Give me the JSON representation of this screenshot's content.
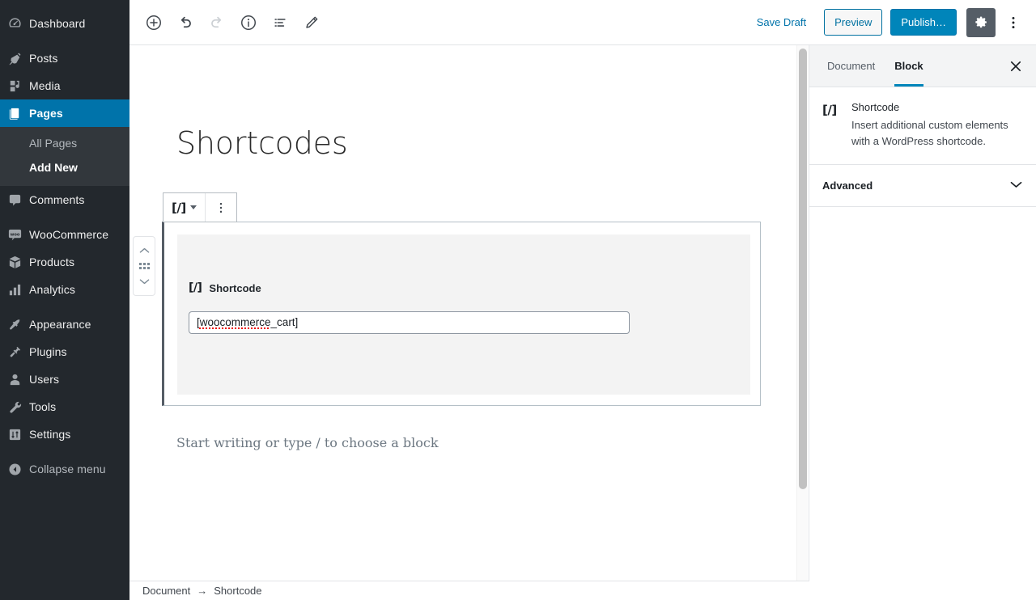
{
  "admin_menu": {
    "items": [
      {
        "label": "Dashboard",
        "icon": "dashboard-icon",
        "current": false,
        "gap_after": true
      },
      {
        "label": "Posts",
        "icon": "pin-icon",
        "current": false,
        "gap_after": false
      },
      {
        "label": "Media",
        "icon": "media-icon",
        "current": false,
        "gap_after": false
      },
      {
        "label": "Pages",
        "icon": "pages-icon",
        "current": true,
        "gap_after": false
      },
      {
        "label": "Comments",
        "icon": "comments-icon",
        "current": false,
        "gap_after": true
      },
      {
        "label": "WooCommerce",
        "icon": "woocommerce-icon",
        "current": false,
        "gap_after": false
      },
      {
        "label": "Products",
        "icon": "products-icon",
        "current": false,
        "gap_after": false
      },
      {
        "label": "Analytics",
        "icon": "analytics-icon",
        "current": false,
        "gap_after": true
      },
      {
        "label": "Appearance",
        "icon": "appearance-icon",
        "current": false,
        "gap_after": false
      },
      {
        "label": "Plugins",
        "icon": "plugins-icon",
        "current": false,
        "gap_after": false
      },
      {
        "label": "Users",
        "icon": "users-icon",
        "current": false,
        "gap_after": false
      },
      {
        "label": "Tools",
        "icon": "tools-icon",
        "current": false,
        "gap_after": false
      },
      {
        "label": "Settings",
        "icon": "settings-icon",
        "current": false,
        "gap_after": true
      }
    ],
    "pages_submenu": [
      {
        "label": "All Pages",
        "current": false
      },
      {
        "label": "Add New",
        "current": true
      }
    ],
    "collapse_label": "Collapse menu",
    "highlight_color": "#0073aa",
    "background_color": "#23282d",
    "submenu_background": "#32373c"
  },
  "header": {
    "tools": [
      {
        "name": "add-block-icon",
        "title": "Add block",
        "disabled": false
      },
      {
        "name": "undo-icon",
        "title": "Undo",
        "disabled": false
      },
      {
        "name": "redo-icon",
        "title": "Redo",
        "disabled": true
      },
      {
        "name": "info-icon",
        "title": "Content structure",
        "disabled": false
      },
      {
        "name": "block-navigation-icon",
        "title": "Block navigation",
        "disabled": false
      },
      {
        "name": "pencil-icon",
        "title": "Edit",
        "disabled": false
      }
    ],
    "save_draft_label": "Save Draft",
    "preview_label": "Preview",
    "publish_label": "Publish…",
    "settings_gear_name": "gear-icon",
    "more_menu_name": "kebab-menu-icon",
    "primary_color": "#0085ba",
    "link_color": "#0073aa",
    "gear_active_background": "#555d66"
  },
  "editor": {
    "post_title": "Shortcodes",
    "default_block_placeholder": "Start writing or type / to choose a block",
    "block_toolbar": {
      "block_type_icon": "[/]",
      "block_type_name": "shortcode-block-switcher",
      "more_options_name": "block-options-kebab-icon"
    },
    "mover": {
      "up_name": "move-block-up-icon",
      "drag_name": "drag-handle-icon",
      "down_name": "move-block-down-icon"
    },
    "shortcode_block": {
      "icon": "[/]",
      "label": "Shortcode",
      "value": "[woocommerce_cart]",
      "misspelled_part": "woocommerce",
      "rest_part": "_cart]",
      "lead_part": "["
    }
  },
  "settings_sidebar": {
    "tabs": [
      {
        "label": "Document",
        "active": false
      },
      {
        "label": "Block",
        "active": true
      }
    ],
    "close_name": "close-icon",
    "block_card": {
      "icon": "[/]",
      "title": "Shortcode",
      "description": "Insert additional custom elements with a WordPress shortcode."
    },
    "panels": [
      {
        "title": "Advanced",
        "expanded": false
      }
    ],
    "active_tab_underline_color": "#0085ba"
  },
  "footer": {
    "breadcrumbs": [
      {
        "label": "Document"
      },
      {
        "label": "Shortcode"
      }
    ],
    "separator": "→"
  }
}
